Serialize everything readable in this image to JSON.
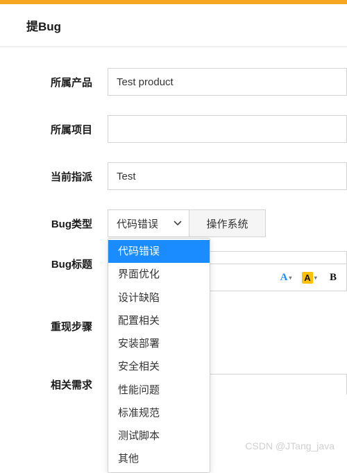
{
  "header": {
    "title": "提Bug"
  },
  "fields": {
    "product": {
      "label": "所属产品",
      "value": "Test product"
    },
    "project": {
      "label": "所属项目",
      "value": ""
    },
    "assigned": {
      "label": "当前指派",
      "value": "Test"
    },
    "bugtype": {
      "label": "Bug类型",
      "value": "代码错误"
    },
    "os_button": "操作系统",
    "title_field": {
      "label": "Bug标题"
    },
    "steps": {
      "label": "重现步骤"
    },
    "requirement": {
      "label": "相关需求"
    }
  },
  "bugtype_options": [
    "代码错误",
    "界面优化",
    "设计缺陷",
    "配置相关",
    "安装部署",
    "安全相关",
    "性能问题",
    "标准规范",
    "测试脚本",
    "其他"
  ],
  "toolbar": {
    "fontcolor": "A",
    "highlight": "A",
    "bold": "B"
  },
  "watermark": "CSDN @JTang_java"
}
